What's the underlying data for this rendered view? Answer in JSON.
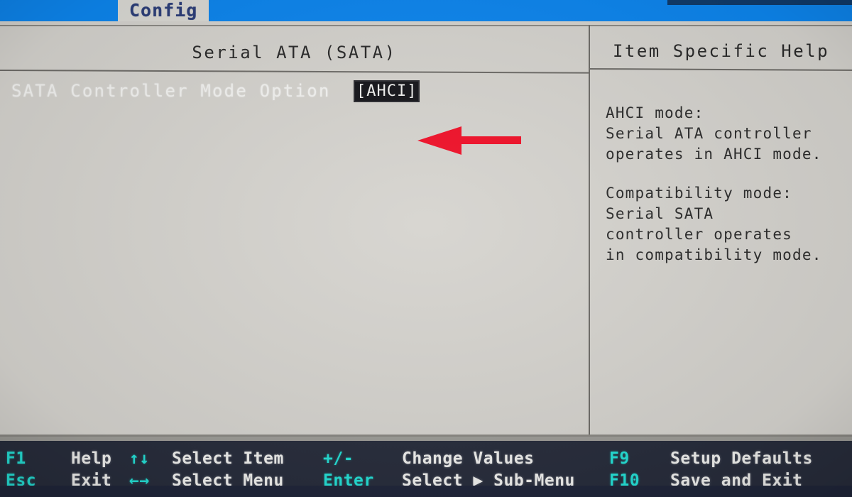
{
  "tabbar": {
    "active_tab": "Config",
    "background_color": "#0d86ef",
    "active_tab_text_color": "#2d3f7a"
  },
  "main_panel": {
    "title": "Serial ATA (SATA)",
    "settings": [
      {
        "label": "SATA Controller Mode Option",
        "value": "[AHCI]",
        "selected": true
      }
    ]
  },
  "help_panel": {
    "title": "Item Specific Help",
    "paragraphs": [
      {
        "lines": [
          "AHCI mode:",
          "Serial ATA controller",
          "operates in AHCI mode."
        ]
      },
      {
        "lines": [
          "Compatibility mode:",
          "Serial SATA",
          "controller operates",
          "in compatibility mode."
        ]
      }
    ]
  },
  "annotation": {
    "arrow_color": "#f01028",
    "points_to": "[AHCI]"
  },
  "statusbar": {
    "key_color": "#25e0d6",
    "desc_color": "#f0f0ee",
    "background_color": "#282d3c",
    "groups": [
      {
        "id": "help",
        "rows": [
          {
            "key": "F1",
            "desc": "Help"
          },
          {
            "key": "Esc",
            "desc": "Exit"
          }
        ]
      },
      {
        "id": "select",
        "rows": [
          {
            "key": "↑↓",
            "desc": "Select Item"
          },
          {
            "key": "←→",
            "desc": "Select Menu"
          }
        ]
      },
      {
        "id": "change",
        "rows": [
          {
            "key": "+/-",
            "desc": "Change Values"
          },
          {
            "key": "Enter",
            "desc": "Select ▶ Sub-Menu"
          }
        ]
      },
      {
        "id": "save",
        "rows": [
          {
            "key": "F9",
            "desc": "Setup Defaults"
          },
          {
            "key": "F10",
            "desc": "Save and Exit"
          }
        ]
      }
    ]
  }
}
